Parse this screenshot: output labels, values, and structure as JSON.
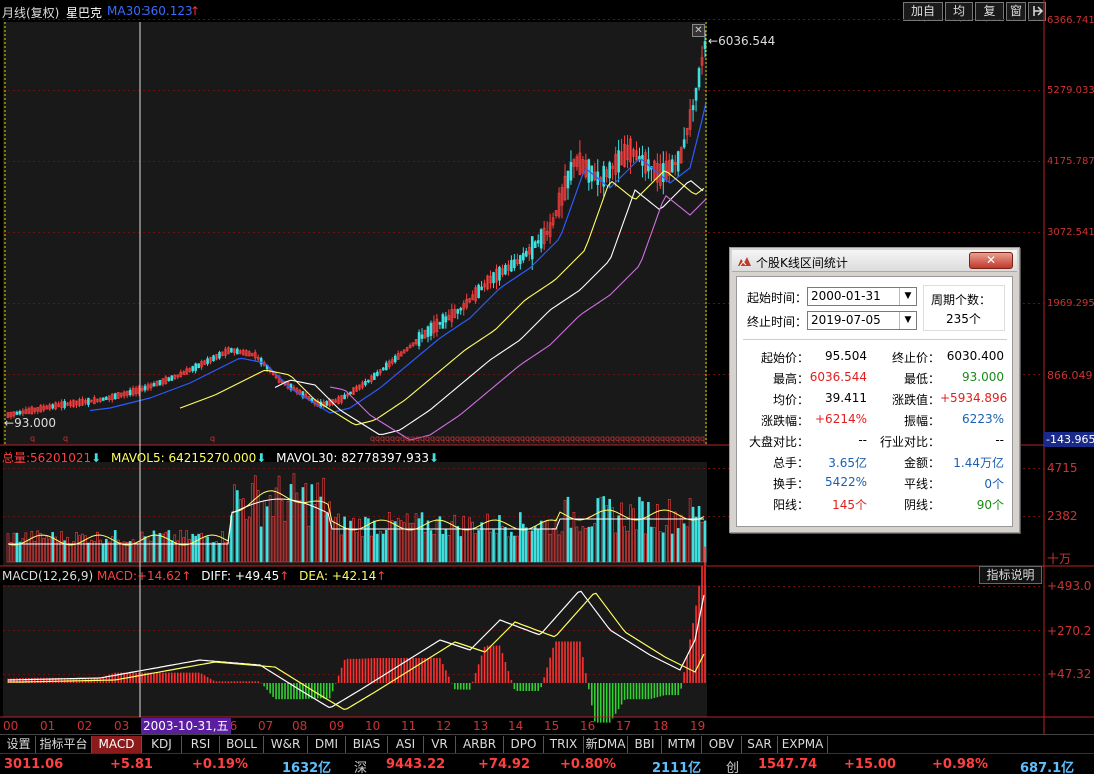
{
  "header": {
    "period": "月线(复权)",
    "stock": "星巴克",
    "ma_label": "MA30:",
    "ma_value": "360.123",
    "ma_arrow": "↑",
    "buttons": [
      "加自选",
      "均线",
      "复权",
      "窗"
    ],
    "exit_icon": "exit-icon"
  },
  "price_axis": [
    "6366.741",
    "5279.033",
    "4175.787",
    "3072.541",
    "1969.295",
    "866.049",
    "-143.965"
  ],
  "price_chart": {
    "type": "candlestick",
    "high_label": "6036.544",
    "low_label": "93.000",
    "colors": {
      "up": "#ff4040",
      "down": "#40e0e0",
      "ma1": "#2a5cff",
      "ma2": "#ffff60",
      "ma3": "#ffffff",
      "ma4": "#d070e0"
    }
  },
  "volume": {
    "label_total": "总量:",
    "total": "56201021",
    "mavol5_label": "MAVOL5:",
    "mavol5": "64215270.000",
    "mavol30_label": "MAVOL30:",
    "mavol30": "82778397.933",
    "axis": [
      "4715",
      "2382"
    ],
    "unit": "十万"
  },
  "macd": {
    "label": "MACD(12,26,9)",
    "macd_label": "MACD:",
    "macd": "+14.62",
    "diff_label": "DIFF:",
    "diff": "+49.45",
    "dea_label": "DEA:",
    "dea": "+42.14",
    "axis": [
      "+493.0",
      "+270.2",
      "+47.32"
    ],
    "help_button": "指标说明"
  },
  "time_axis": {
    "labels": [
      "00",
      "01",
      "02",
      "03",
      "04",
      "05",
      "06",
      "07",
      "08",
      "09",
      "10",
      "11",
      "12",
      "13",
      "14",
      "15",
      "16",
      "17",
      "18",
      "19"
    ],
    "cursor_label": "2003-10-31,五"
  },
  "tabs": [
    "设置",
    "指标平台",
    "MACD",
    "KDJ",
    "RSI",
    "BOLL",
    "W&R",
    "DMI",
    "BIAS",
    "ASI",
    "VR",
    "ARBR",
    "DPO",
    "TRIX",
    "新DMA",
    "BBI",
    "MTM",
    "OBV",
    "SAR",
    "EXPMA"
  ],
  "active_tab": "MACD",
  "status": {
    "sh_index": "3011.06",
    "sh_chg": "+5.81",
    "sh_pct": "+0.19%",
    "sh_amt": "1632亿",
    "sz_name": "深",
    "sz_index": "9443.22",
    "sz_chg": "+74.92",
    "sz_pct": "+0.80%",
    "sz_amt": "2111亿",
    "cy_name": "创",
    "cy_index": "1547.74",
    "cy_chg": "+15.00",
    "cy_pct": "+0.98%",
    "cy_amt": "687.1亿"
  },
  "dialog": {
    "title": "个股K线区间统计",
    "close": "✕",
    "start_label": "起始时间：",
    "start_value": "2000-01-31",
    "end_label": "终止时间：",
    "end_value": "2019-07-05",
    "period_count_label": "周期个数：",
    "period_count": "235个",
    "rows": [
      {
        "l1": "起始价：",
        "v1": "95.504",
        "c1": "blk",
        "l2": "终止价：",
        "v2": "6030.400",
        "c2": "blk"
      },
      {
        "l1": "最高：",
        "v1": "6036.544",
        "c1": "red",
        "l2": "最低：",
        "v2": "93.000",
        "c2": "green"
      },
      {
        "l1": "均价：",
        "v1": "39.411",
        "c1": "blk",
        "l2": "涨跌值：",
        "v2": "+5934.896",
        "c2": "red"
      },
      {
        "l1": "涨跌幅：",
        "v1": "+6214%",
        "c1": "red",
        "l2": "振幅：",
        "v2": "6223%",
        "c2": "blue"
      },
      {
        "l1": "大盘对比：",
        "v1": "--",
        "c1": "blk",
        "l2": "行业对比：",
        "v2": "--",
        "c2": "blk"
      },
      {
        "l1": "总手：",
        "v1": "3.65亿",
        "c1": "blue",
        "l2": "金额：",
        "v2": "1.44万亿",
        "c2": "blue"
      },
      {
        "l1": "换手：",
        "v1": "5422%",
        "c1": "blue",
        "l2": "平线：",
        "v2": "0个",
        "c2": "blue"
      },
      {
        "l1": "阳线：",
        "v1": "145个",
        "c1": "red",
        "l2": "阴线：",
        "v2": "90个",
        "c2": "green"
      }
    ]
  }
}
